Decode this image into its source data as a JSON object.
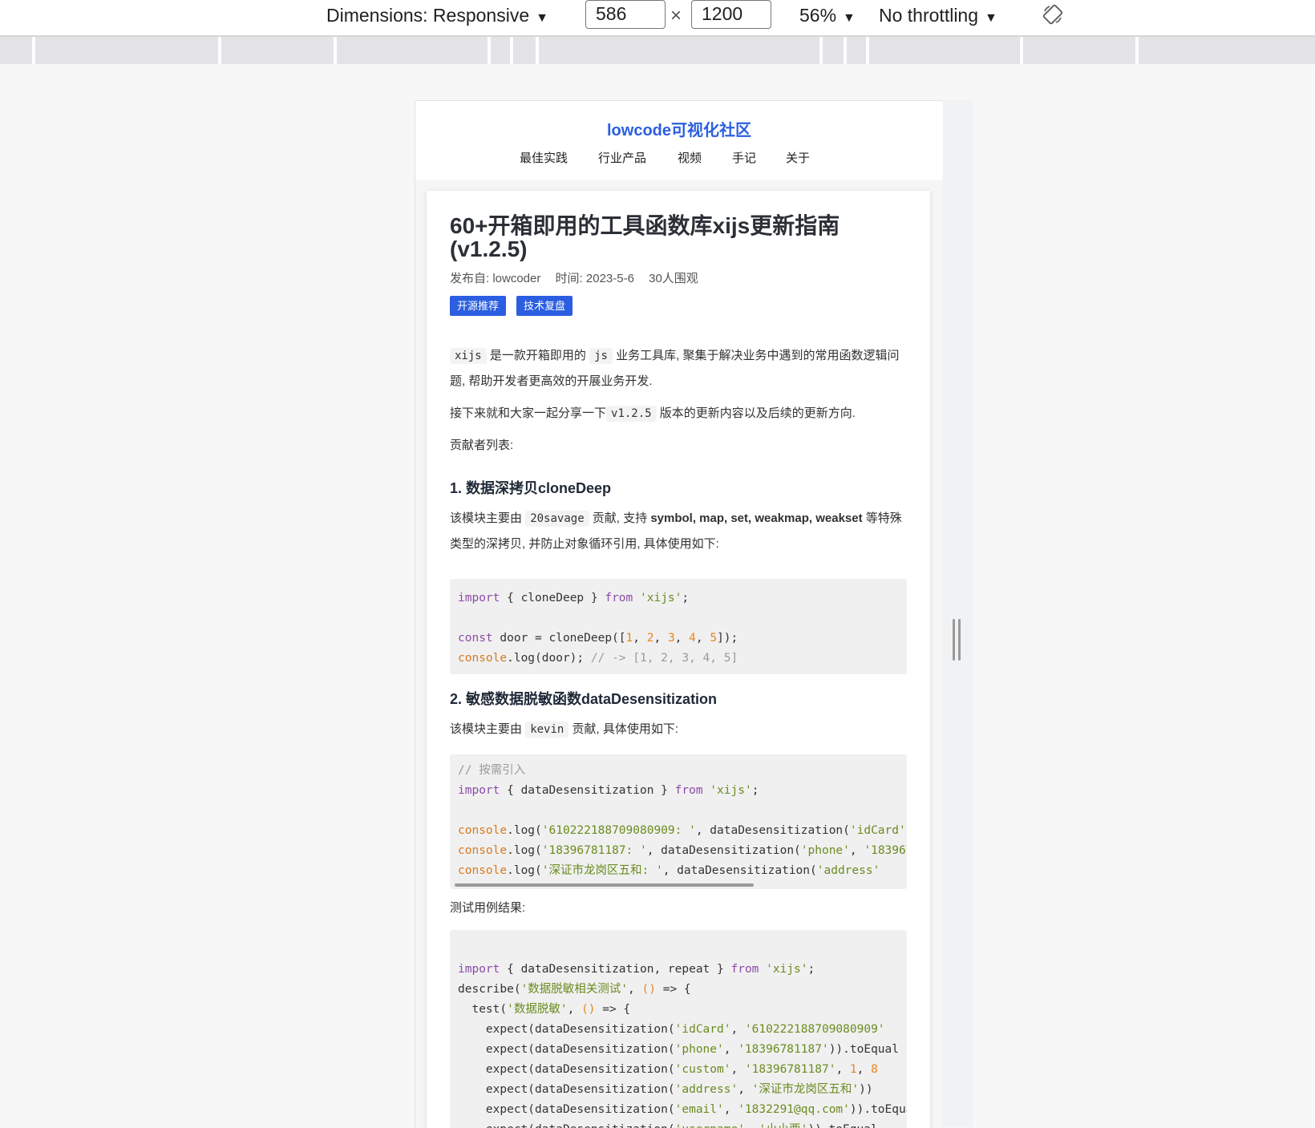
{
  "devtools": {
    "dimensions_label": "Dimensions: Responsive",
    "width": "586",
    "times": "×",
    "height": "1200",
    "zoom": "56%",
    "throttle": "No throttling",
    "caret": "▼"
  },
  "site": {
    "brand": "lowcode可视化社区",
    "nav": [
      "最佳实践",
      "行业产品",
      "视频",
      "手记",
      "关于"
    ]
  },
  "article": {
    "title": "60+开箱即用的工具函数库xijs更新指南(v1.2.5)",
    "meta": {
      "author": "发布自: lowcoder",
      "time": "时间: 2023-5-6",
      "views": "30人围观"
    },
    "tags": [
      "开源推荐",
      "技术复盘"
    ],
    "intro": {
      "code1": "xijs",
      "text1": "是一款开箱即用的",
      "code2": "js",
      "text2": "业务工具库, 聚集于解决业务中遇到的常用函数逻辑问题, 帮助开发者更高效的开展业务开发."
    },
    "next": {
      "text1": "接下来就和大家一起分享一下",
      "code": "v1.2.5",
      "text2": "版本的更新内容以及后续的更新方向."
    },
    "contributors": "贡献者列表:",
    "section1": {
      "heading": "1. 数据深拷贝cloneDeep",
      "text1": "该模块主要由",
      "code": "20savage",
      "text2": "贡献, 支持",
      "bold": "symbol, map, set, weakmap, weakset",
      "text3": "等特殊类型的深拷贝, 并防止对象循环引用, 具体使用如下:"
    },
    "section2": {
      "heading": "2. 敏感数据脱敏函数dataDesensitization",
      "text1": "该模块主要由",
      "code": "kevin",
      "text2": "贡献, 具体使用如下:"
    },
    "results_label": "测试用例结果:"
  }
}
